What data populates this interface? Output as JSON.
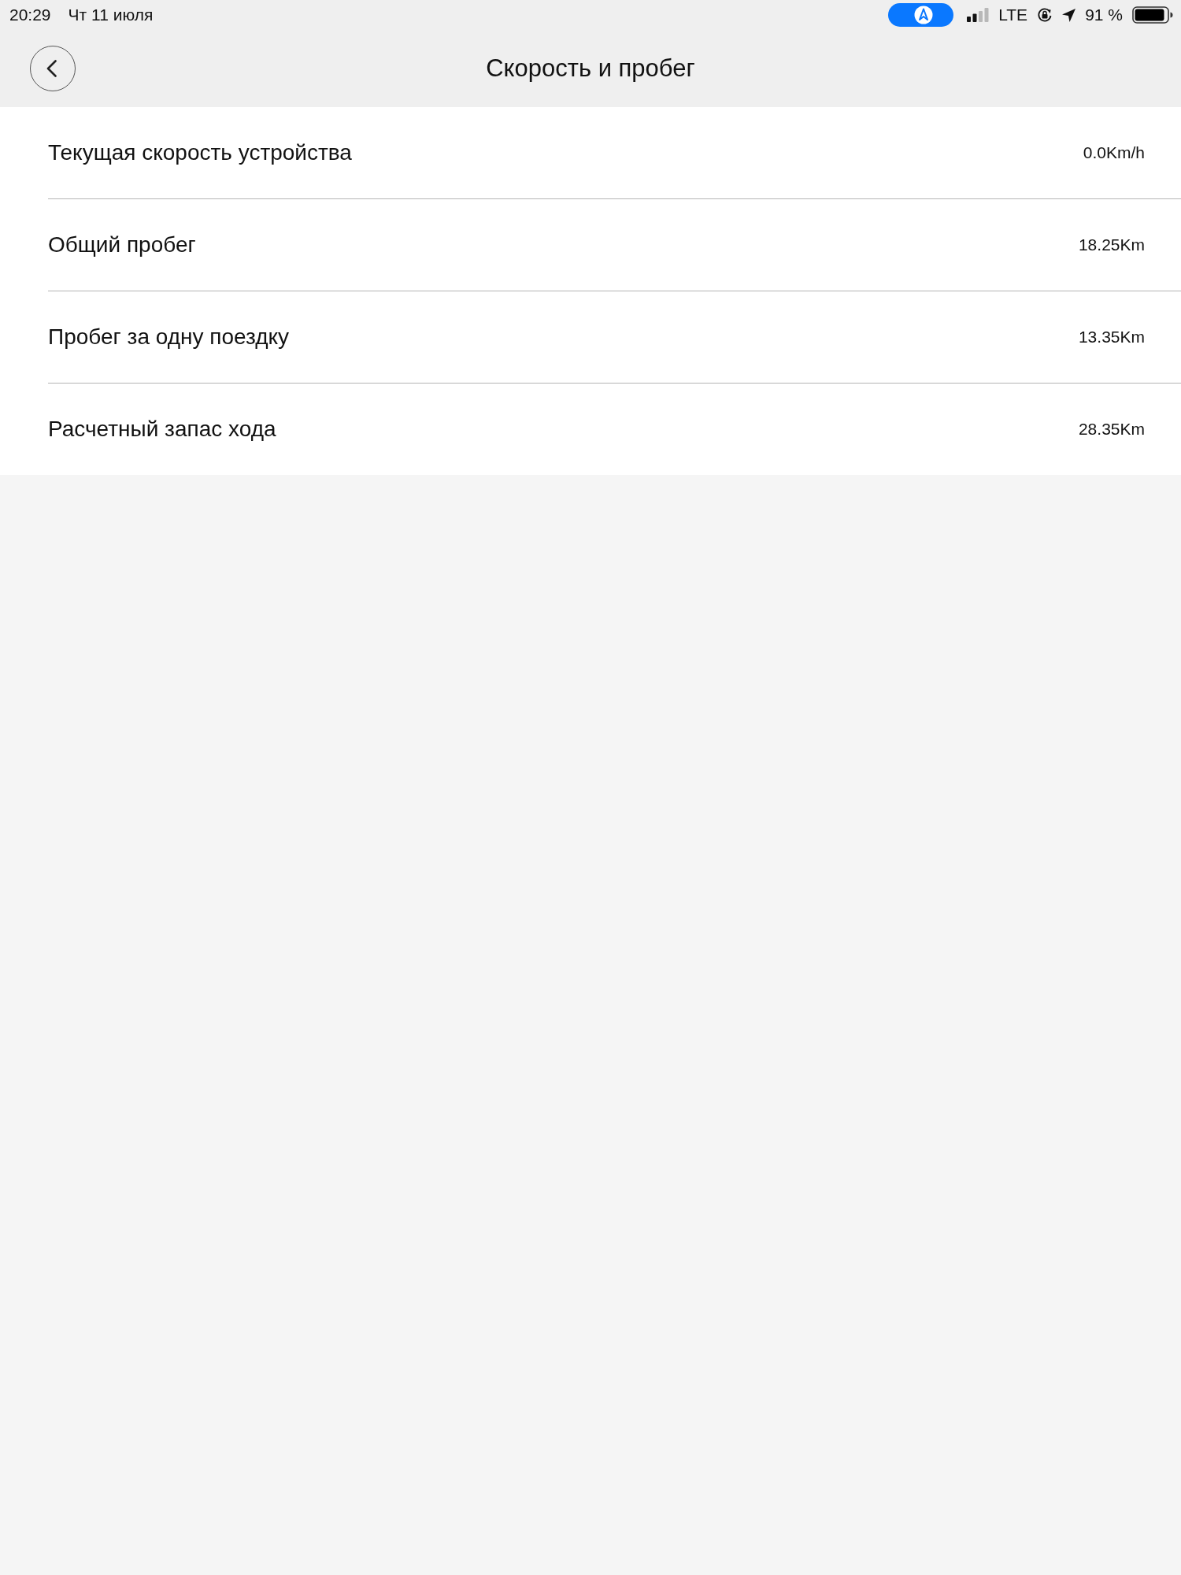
{
  "status_bar": {
    "time": "20:29",
    "date": "Чт 11 июля",
    "network": "LTE",
    "battery": "91 %"
  },
  "header": {
    "title": "Скорость и пробег"
  },
  "rows": [
    {
      "label": "Текущая скорость устройства",
      "value": "0.0Km/h"
    },
    {
      "label": "Общий пробег",
      "value": "18.25Km"
    },
    {
      "label": "Пробег за одну поездку",
      "value": "13.35Km"
    },
    {
      "label": "Расчетный запас хода",
      "value": "28.35Km"
    }
  ]
}
